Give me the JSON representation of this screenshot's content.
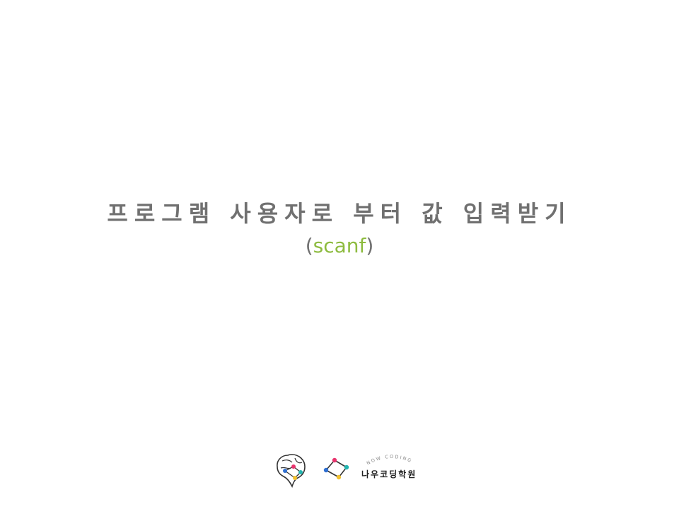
{
  "slide": {
    "title": "프로그램 사용자로 부터 값 입력받기",
    "subtitle_open": "(",
    "subtitle_keyword": "scanf",
    "subtitle_close": ")"
  },
  "brand": {
    "tagline": "NOW CODING",
    "name": "나우코딩학원"
  },
  "colors": {
    "title_gray": "#707070",
    "accent_green": "#8dbb3f",
    "logo_pink": "#e8336d",
    "logo_blue": "#2f6fd1",
    "logo_teal": "#22b5b0",
    "logo_yellow": "#f2c12e"
  },
  "icons": {
    "brain_logo": "brain-network-logo",
    "network_logo": "connected-dots-logo"
  }
}
